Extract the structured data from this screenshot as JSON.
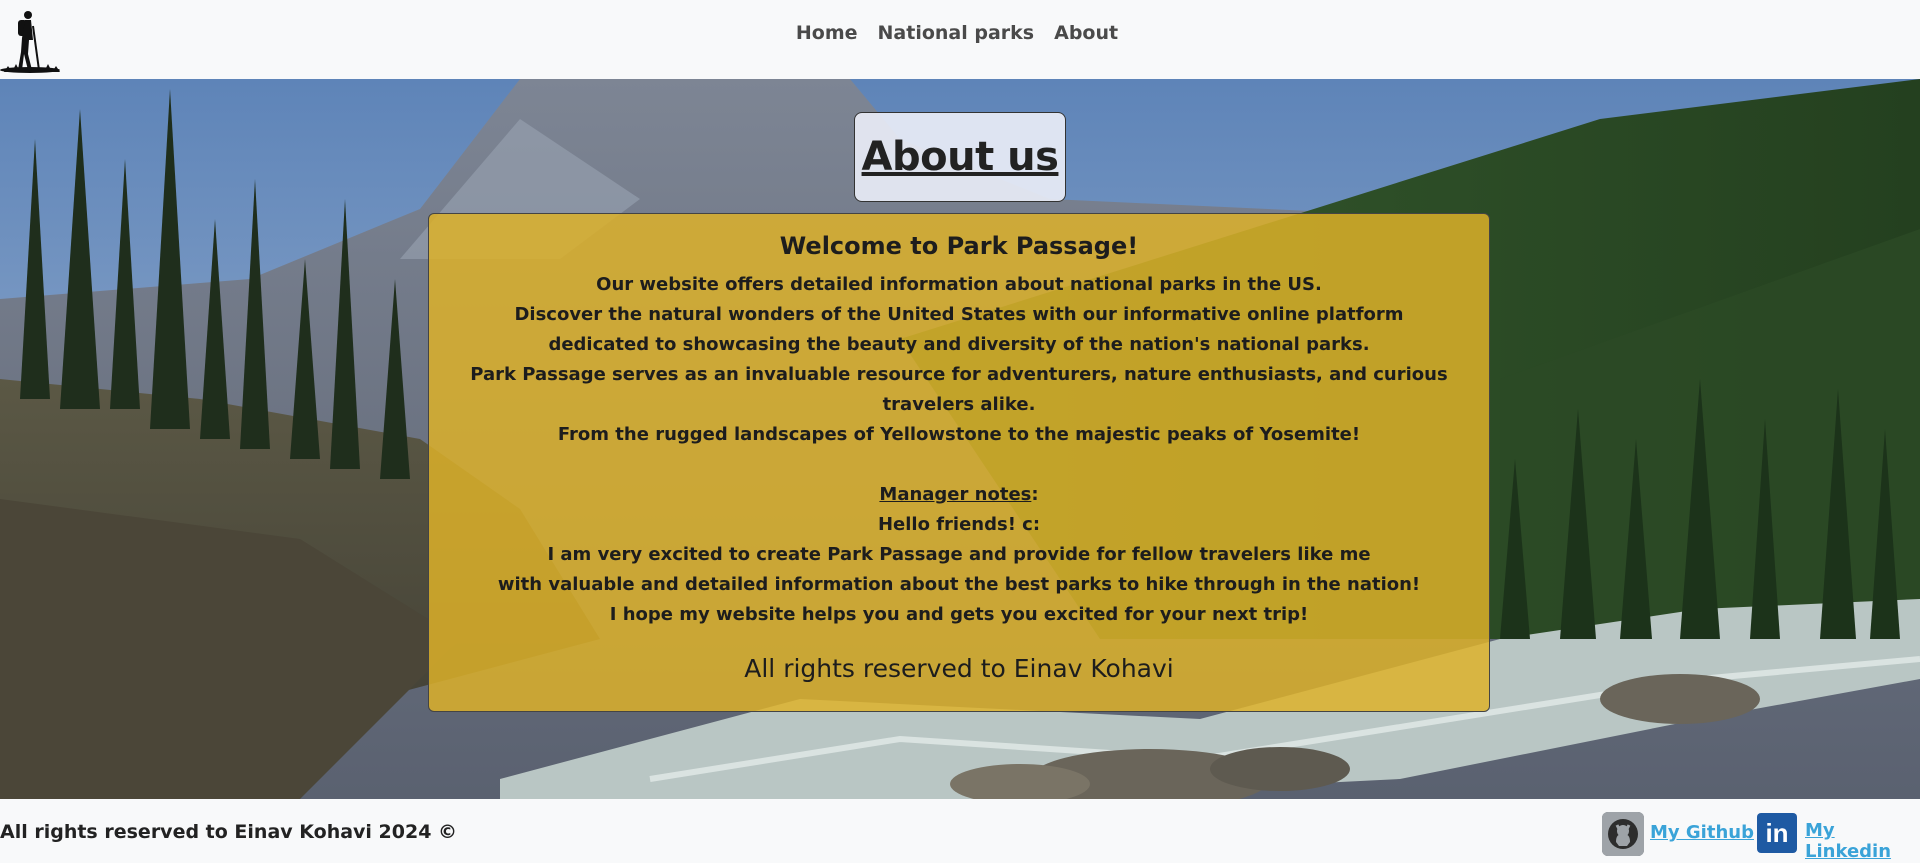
{
  "nav": {
    "items": [
      {
        "label": "Home"
      },
      {
        "label": "National parks"
      },
      {
        "label": "About"
      }
    ],
    "logo_icon": "hiker-silhouette-icon"
  },
  "hero": {
    "title": "About us",
    "card": {
      "heading": "Welcome to Park Passage!",
      "intro_lines": [
        "Our website offers detailed information about national parks in the US.",
        "Discover the natural wonders of the United States with our informative online platform",
        "dedicated to showcasing the beauty and diversity of the nation's national parks.",
        "Park Passage serves as an invaluable resource for adventurers, nature enthusiasts, and curious travelers alike.",
        "From the rugged landscapes of Yellowstone to the majestic peaks of Yosemite!"
      ],
      "manager_label": "Manager notes",
      "manager_colon": ":",
      "note_lines": [
        "Hello friends! c:",
        "I am very excited to create Park Passage and provide for fellow travelers like me",
        "with valuable and detailed information about the best parks to hike through in the nation!",
        "I hope my website helps you and gets you excited for your next trip!"
      ],
      "rights": "All rights reserved to Einav Kohavi"
    }
  },
  "footer": {
    "copyright": "All rights reserved to Einav Kohavi 2024 ©",
    "github_label": "My Github",
    "linkedin_label": "My Linkedin",
    "linkedin_icon_text": "in"
  },
  "colors": {
    "card": "#deb228",
    "link": "#3aa3d8",
    "linkedin": "#1e5aa3"
  }
}
